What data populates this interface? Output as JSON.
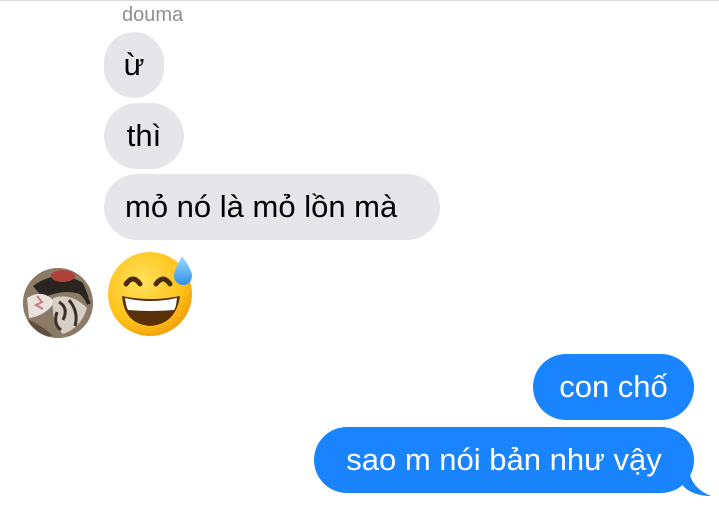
{
  "conversation": {
    "sender_name": "douma",
    "incoming": [
      {
        "text": "ừ"
      },
      {
        "text": "thì"
      },
      {
        "text": "mỏ nó là mỏ lồn mà"
      }
    ],
    "outgoing": [
      {
        "text": "con chố"
      },
      {
        "text": "sao m nói bản như vậy"
      }
    ],
    "emoji_message": "grinning-face-with-sweat"
  },
  "colors": {
    "incoming_bubble": "#e5e5ea",
    "outgoing_bubble": "#1a84ff",
    "sender_name": "#8e8e93"
  },
  "icons": {
    "avatar": "sender-avatar-photo",
    "emoji": "grinning-face-with-sweat-icon"
  }
}
